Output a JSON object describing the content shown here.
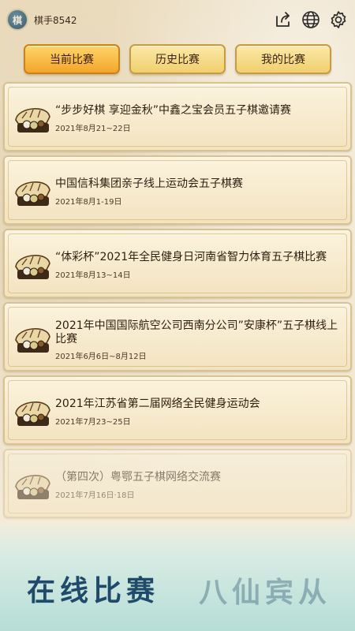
{
  "header": {
    "avatar_text": "棋",
    "username": "棋手8542",
    "icons": [
      "share-icon",
      "globe-icon",
      "gear-icon"
    ]
  },
  "tabs": [
    {
      "label": "当前比赛",
      "active": true
    },
    {
      "label": "历史比赛",
      "active": false
    },
    {
      "label": "我的比赛",
      "active": false
    }
  ],
  "matches": [
    {
      "title": "“步步好棋 享迎金秋”中鑫之宝会员五子棋邀请赛",
      "date": "2021年8月21~22日"
    },
    {
      "title": "中国信科集团亲子线上运动会五子棋赛",
      "date": "2021年8月1-19日"
    },
    {
      "title": "“体彩杯”2021年全民健身日河南省智力体育五子棋比赛",
      "date": "2021年8月13~14日"
    },
    {
      "title": "2021年中国国际航空公司西南分公司”安康杯”五子棋线上比赛",
      "date": "2021年6月6日~8月12日"
    },
    {
      "title": "2021年江苏省第二届网络全民健身运动会",
      "date": "2021年7月23~25日"
    },
    {
      "title": "（第四次）粤鄂五子棋网络交流赛",
      "date": "2021年7月16日·18日"
    }
  ],
  "banner": {
    "text": "在线比赛",
    "text_faded": "八仙宾从"
  },
  "colors": {
    "accent": "#f3a52a",
    "tab": "#f0cf6e",
    "card": "#f3e3bf",
    "banner_text": "#1f4a6a"
  }
}
